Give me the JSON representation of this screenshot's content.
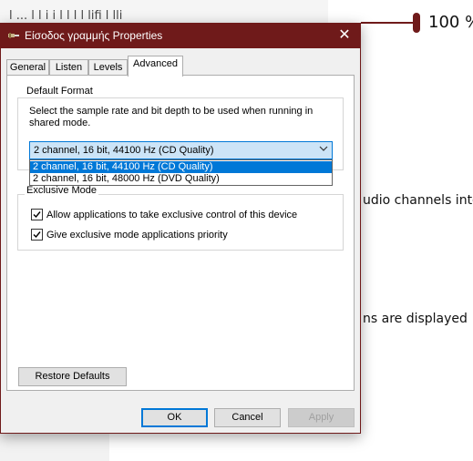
{
  "background": {
    "top_strip_text": "l  ...   l     l  i   i  l  l    l   l     lifi  l  lli",
    "volume_value": "100 %",
    "text_line_1": "udio channels into",
    "text_line_2": "ns are displayed"
  },
  "dialog": {
    "title": "Είσοδος γραμμής Properties",
    "close_glyph": "✕",
    "tabs": [
      {
        "label": "General"
      },
      {
        "label": "Listen"
      },
      {
        "label": "Levels"
      },
      {
        "label": "Advanced"
      }
    ],
    "active_tab": "Advanced",
    "default_format": {
      "group_label": "Default Format",
      "description": "Select the sample rate and bit depth to be used when running in shared mode.",
      "selected_value": "2 channel, 16 bit, 44100 Hz (CD Quality)",
      "options": [
        "2 channel, 16 bit, 44100 Hz (CD Quality)",
        "2 channel, 16 bit, 48000 Hz (DVD Quality)"
      ]
    },
    "exclusive_mode": {
      "group_label": "Exclusive Mode",
      "allow_exclusive_label": "Allow applications to take exclusive control of this device",
      "allow_exclusive_checked": true,
      "priority_label": "Give exclusive mode applications priority",
      "priority_checked": true
    },
    "restore_defaults_label": "Restore Defaults",
    "ok_label": "OK",
    "cancel_label": "Cancel",
    "apply_label": "Apply"
  },
  "colors": {
    "accent": "#6f1a1a",
    "selection": "#0078d7"
  }
}
